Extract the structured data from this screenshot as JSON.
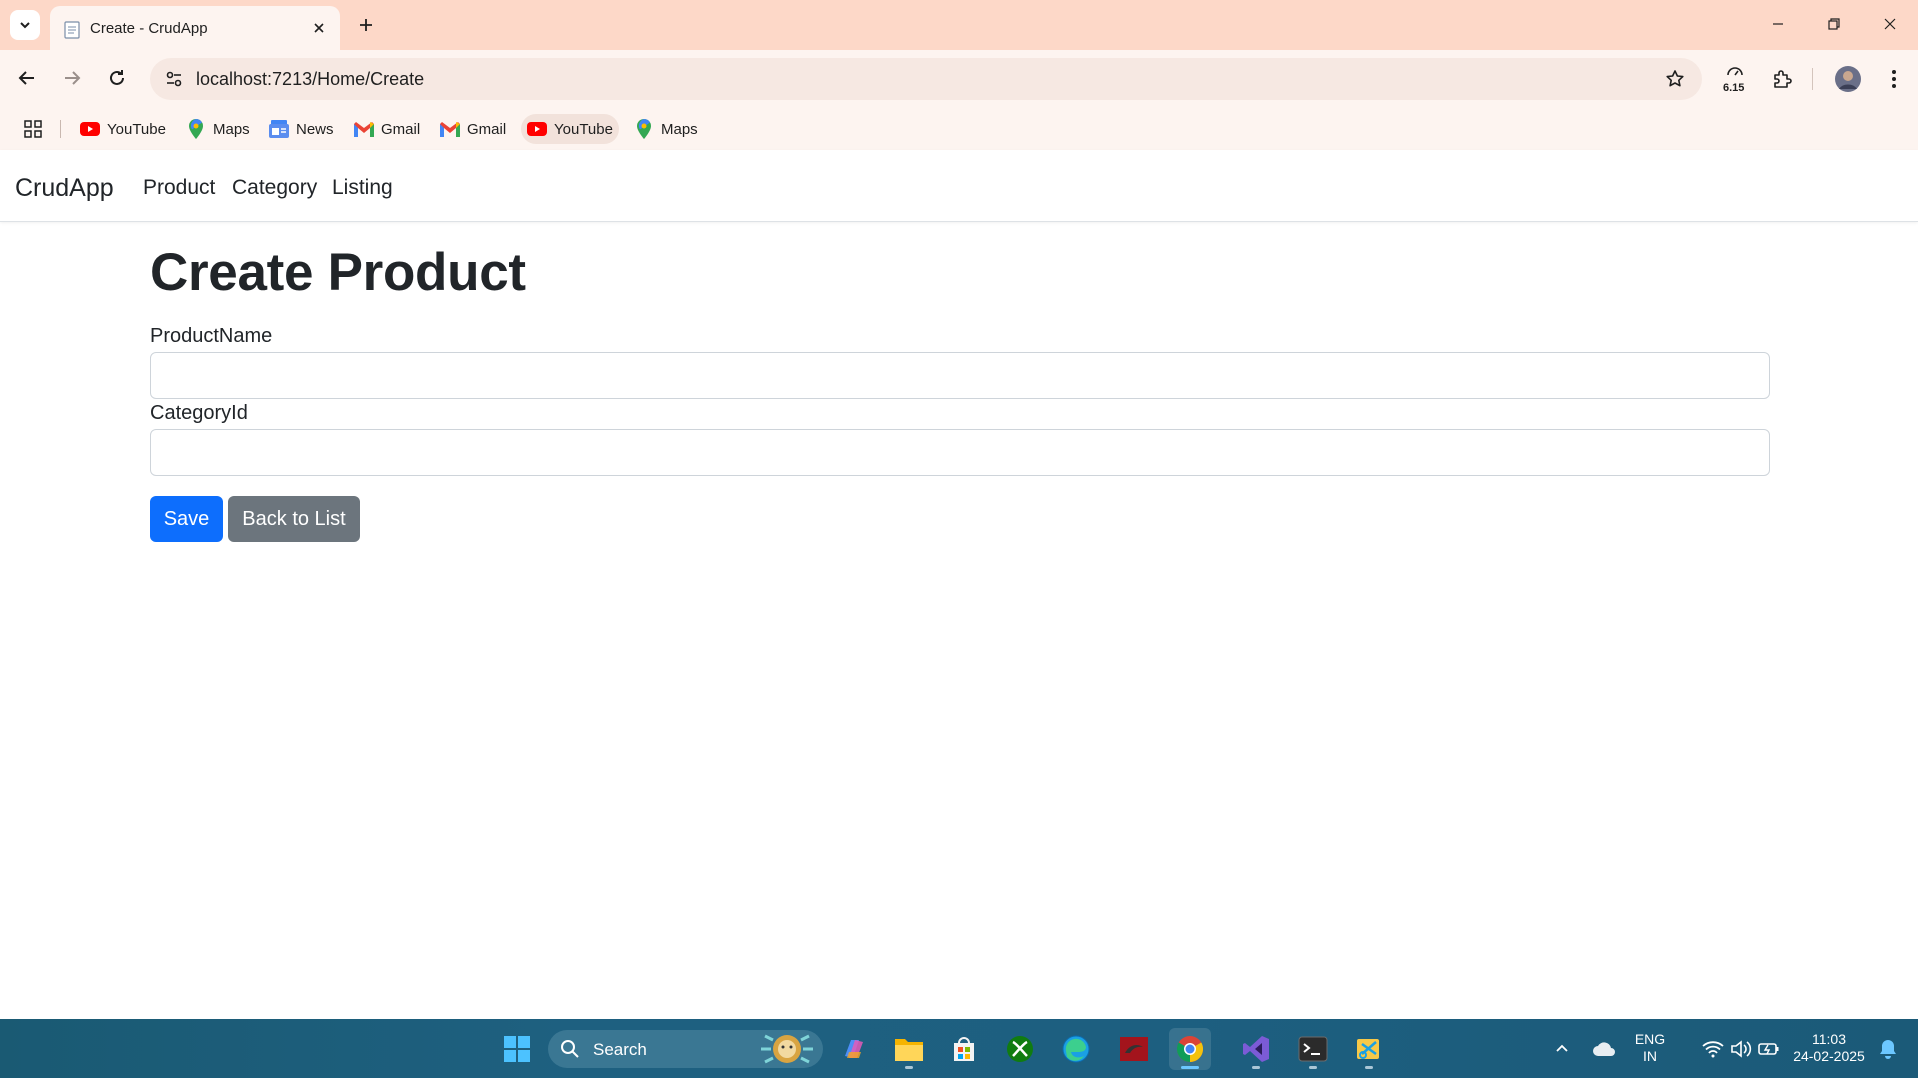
{
  "browser": {
    "tab_title": "Create - CrudApp",
    "url": "localhost:7213/Home/Create",
    "perf_badge": "6.15",
    "bookmarks": [
      {
        "label": "YouTube",
        "icon": "youtube-icon"
      },
      {
        "label": "Maps",
        "icon": "maps-icon"
      },
      {
        "label": "News",
        "icon": "news-icon"
      },
      {
        "label": "Gmail",
        "icon": "gmail-icon"
      },
      {
        "label": "Gmail",
        "icon": "gmail-icon"
      },
      {
        "label": "YouTube",
        "icon": "youtube-icon"
      },
      {
        "label": "Maps",
        "icon": "maps-icon"
      }
    ]
  },
  "app": {
    "brand": "CrudApp",
    "nav": [
      "Product",
      "Category",
      "Listing"
    ],
    "page_title": "Create Product",
    "fields": {
      "product_name_label": "ProductName",
      "product_name_value": "",
      "category_id_label": "CategoryId",
      "category_id_value": ""
    },
    "buttons": {
      "save": "Save",
      "back": "Back to List"
    }
  },
  "taskbar": {
    "search_label": "Search",
    "lang_line1": "ENG",
    "lang_line2": "IN",
    "time": "11:03",
    "date": "24-02-2025"
  },
  "colors": {
    "primary": "#0d6efd",
    "secondary": "#6c757d",
    "tab_strip": "#fdd8c8"
  }
}
